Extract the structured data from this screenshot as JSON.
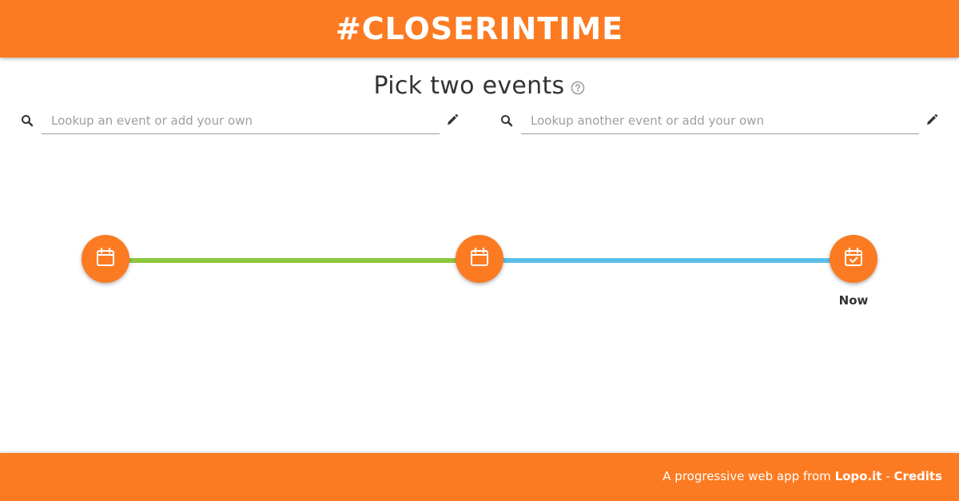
{
  "header": {
    "title": "#CLOSERINTIME"
  },
  "main": {
    "heading": "Pick two events",
    "help_icon": "help-circle-icon",
    "search_left": {
      "placeholder": "Lookup an event or add your own",
      "value": "",
      "icon": "search-icon",
      "edit_icon": "pencil-icon"
    },
    "search_right": {
      "placeholder": "Lookup another event or add your own",
      "value": "",
      "icon": "search-icon",
      "edit_icon": "pencil-icon"
    }
  },
  "timeline": {
    "nodes": [
      {
        "icon": "calendar-icon",
        "label": ""
      },
      {
        "icon": "calendar-icon",
        "label": ""
      },
      {
        "icon": "calendar-check-icon",
        "label": "Now"
      }
    ],
    "segment_colors": [
      "#8dc63f",
      "#5bc0eb"
    ]
  },
  "footer": {
    "prefix": "A progressive web app from ",
    "brand_link": "Lopo.it",
    "separator": " - ",
    "credits_link": "Credits"
  },
  "colors": {
    "accent": "#fc7b22",
    "text": "#333333",
    "muted": "#9e9e9e"
  }
}
